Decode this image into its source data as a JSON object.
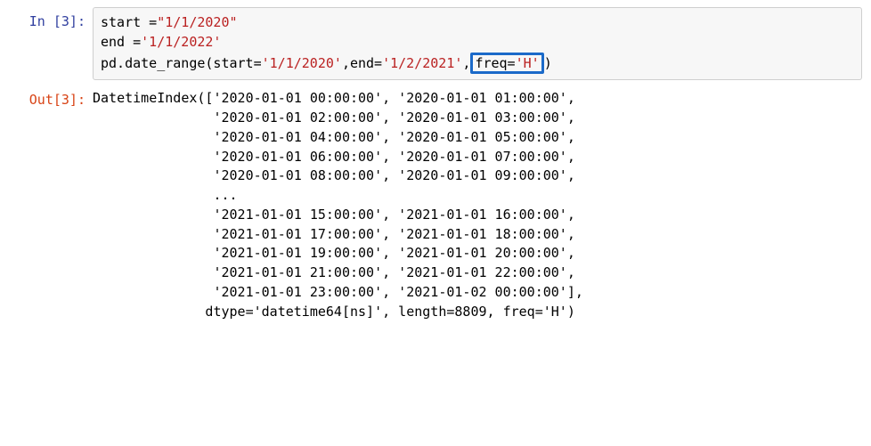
{
  "cells": {
    "input": {
      "prompt": "In [3]:",
      "line1": {
        "pre": "start =",
        "str": "\"1/1/2020\""
      },
      "line2": {
        "pre": "end =",
        "str": "'1/1/2022'"
      },
      "line3": {
        "pre": "pd.date_range(start=",
        "arg1": "'1/1/2020'",
        "mid": ",end=",
        "arg2": "'1/2/2021'",
        "comma": ",",
        "hi_key": "freq=",
        "hi_val": "'H'",
        "tail": ")"
      }
    },
    "output": {
      "prompt": "Out[3]:",
      "lines": [
        "DatetimeIndex(['2020-01-01 00:00:00', '2020-01-01 01:00:00',",
        "               '2020-01-01 02:00:00', '2020-01-01 03:00:00',",
        "               '2020-01-01 04:00:00', '2020-01-01 05:00:00',",
        "               '2020-01-01 06:00:00', '2020-01-01 07:00:00',",
        "               '2020-01-01 08:00:00', '2020-01-01 09:00:00',",
        "               ...",
        "               '2021-01-01 15:00:00', '2021-01-01 16:00:00',",
        "               '2021-01-01 17:00:00', '2021-01-01 18:00:00',",
        "               '2021-01-01 19:00:00', '2021-01-01 20:00:00',",
        "               '2021-01-01 21:00:00', '2021-01-01 22:00:00',",
        "               '2021-01-01 23:00:00', '2021-01-02 00:00:00'],",
        "              dtype='datetime64[ns]', length=8809, freq='H')"
      ]
    }
  }
}
